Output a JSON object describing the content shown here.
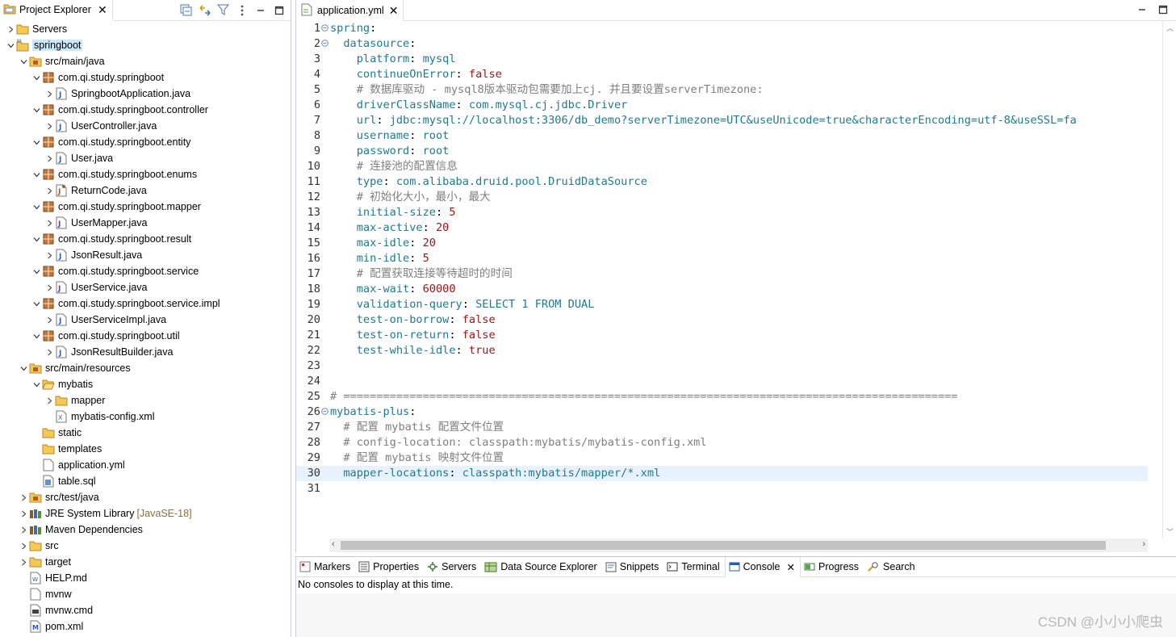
{
  "explorer": {
    "tab_label": "Project Explorer",
    "toolbar_icons": [
      "collapse-all-icon",
      "link-with-editor-icon",
      "filter-icon",
      "view-menu-icon",
      "minimize-icon",
      "maximize-icon"
    ],
    "tree": [
      {
        "label": "Servers",
        "depth": 0,
        "tw": "collapsed",
        "icon": "folder",
        "deco": ""
      },
      {
        "label": "springboot",
        "depth": 0,
        "tw": "expanded",
        "icon": "project",
        "deco": "",
        "selected": true
      },
      {
        "label": "src/main/java",
        "depth": 1,
        "tw": "expanded",
        "icon": "srcfolder",
        "deco": ""
      },
      {
        "label": "com.qi.study.springboot",
        "depth": 2,
        "tw": "expanded",
        "icon": "package",
        "deco": ""
      },
      {
        "label": "SpringbootApplication.java",
        "depth": 3,
        "tw": "collapsed",
        "icon": "java",
        "deco": ""
      },
      {
        "label": "com.qi.study.springboot.controller",
        "depth": 2,
        "tw": "expanded",
        "icon": "package",
        "deco": ""
      },
      {
        "label": "UserController.java",
        "depth": 3,
        "tw": "collapsed",
        "icon": "java",
        "deco": ""
      },
      {
        "label": "com.qi.study.springboot.entity",
        "depth": 2,
        "tw": "expanded",
        "icon": "package",
        "deco": ""
      },
      {
        "label": "User.java",
        "depth": 3,
        "tw": "collapsed",
        "icon": "java",
        "deco": ""
      },
      {
        "label": "com.qi.study.springboot.enums",
        "depth": 2,
        "tw": "expanded",
        "icon": "package",
        "deco": ""
      },
      {
        "label": "ReturnCode.java",
        "depth": 3,
        "tw": "collapsed",
        "icon": "java-enum",
        "deco": ""
      },
      {
        "label": "com.qi.study.springboot.mapper",
        "depth": 2,
        "tw": "expanded",
        "icon": "package",
        "deco": ""
      },
      {
        "label": "UserMapper.java",
        "depth": 3,
        "tw": "collapsed",
        "icon": "java-interface",
        "deco": ""
      },
      {
        "label": "com.qi.study.springboot.result",
        "depth": 2,
        "tw": "expanded",
        "icon": "package",
        "deco": ""
      },
      {
        "label": "JsonResult.java",
        "depth": 3,
        "tw": "collapsed",
        "icon": "java",
        "deco": ""
      },
      {
        "label": "com.qi.study.springboot.service",
        "depth": 2,
        "tw": "expanded",
        "icon": "package",
        "deco": ""
      },
      {
        "label": "UserService.java",
        "depth": 3,
        "tw": "collapsed",
        "icon": "java-interface",
        "deco": ""
      },
      {
        "label": "com.qi.study.springboot.service.impl",
        "depth": 2,
        "tw": "expanded",
        "icon": "package",
        "deco": ""
      },
      {
        "label": "UserServiceImpl.java",
        "depth": 3,
        "tw": "collapsed",
        "icon": "java",
        "deco": ""
      },
      {
        "label": "com.qi.study.springboot.util",
        "depth": 2,
        "tw": "expanded",
        "icon": "package",
        "deco": ""
      },
      {
        "label": "JsonResultBuilder.java",
        "depth": 3,
        "tw": "collapsed",
        "icon": "java",
        "deco": ""
      },
      {
        "label": "src/main/resources",
        "depth": 1,
        "tw": "expanded",
        "icon": "srcfolder",
        "deco": ""
      },
      {
        "label": "mybatis",
        "depth": 2,
        "tw": "expanded",
        "icon": "folder-open",
        "deco": ""
      },
      {
        "label": "mapper",
        "depth": 3,
        "tw": "collapsed",
        "icon": "folder",
        "deco": ""
      },
      {
        "label": "mybatis-config.xml",
        "depth": 3,
        "tw": "none",
        "icon": "xml",
        "deco": ""
      },
      {
        "label": "static",
        "depth": 2,
        "tw": "none",
        "icon": "folder",
        "deco": ""
      },
      {
        "label": "templates",
        "depth": 2,
        "tw": "none",
        "icon": "folder",
        "deco": ""
      },
      {
        "label": "application.yml",
        "depth": 2,
        "tw": "none",
        "icon": "file",
        "deco": ""
      },
      {
        "label": "table.sql",
        "depth": 2,
        "tw": "none",
        "icon": "sql",
        "deco": ""
      },
      {
        "label": "src/test/java",
        "depth": 1,
        "tw": "collapsed",
        "icon": "srcfolder",
        "deco": ""
      },
      {
        "label": "JRE System Library",
        "depth": 1,
        "tw": "collapsed",
        "icon": "library",
        "deco": "[JavaSE-18]"
      },
      {
        "label": "Maven Dependencies",
        "depth": 1,
        "tw": "collapsed",
        "icon": "library",
        "deco": ""
      },
      {
        "label": "src",
        "depth": 1,
        "tw": "collapsed",
        "icon": "folder",
        "deco": ""
      },
      {
        "label": "target",
        "depth": 1,
        "tw": "collapsed",
        "icon": "folder",
        "deco": ""
      },
      {
        "label": "HELP.md",
        "depth": 1,
        "tw": "none",
        "icon": "md",
        "deco": ""
      },
      {
        "label": "mvnw",
        "depth": 1,
        "tw": "none",
        "icon": "file",
        "deco": ""
      },
      {
        "label": "mvnw.cmd",
        "depth": 1,
        "tw": "none",
        "icon": "cmd",
        "deco": ""
      },
      {
        "label": "pom.xml",
        "depth": 1,
        "tw": "none",
        "icon": "pom",
        "deco": ""
      }
    ]
  },
  "editor": {
    "tab_label": "application.yml",
    "current_line": 30,
    "lines": [
      {
        "n": "1",
        "fold": true,
        "segs": [
          [
            "k",
            "spring"
          ],
          [
            "p",
            ":"
          ]
        ]
      },
      {
        "n": "2",
        "fold": true,
        "segs": [
          [
            "p",
            "  "
          ],
          [
            "k",
            "datasource"
          ],
          [
            "p",
            ":"
          ]
        ]
      },
      {
        "n": "3",
        "segs": [
          [
            "p",
            "    "
          ],
          [
            "k",
            "platform"
          ],
          [
            "p",
            ": "
          ],
          [
            "v",
            "mysql"
          ]
        ]
      },
      {
        "n": "4",
        "segs": [
          [
            "p",
            "    "
          ],
          [
            "k",
            "continueOnError"
          ],
          [
            "p",
            ": "
          ],
          [
            "n",
            "false"
          ]
        ]
      },
      {
        "n": "5",
        "segs": [
          [
            "p",
            "    "
          ],
          [
            "c",
            "# 数据库驱动 - mysql8版本驱动包需要加上cj. 并且要设置serverTimezone:"
          ]
        ]
      },
      {
        "n": "6",
        "segs": [
          [
            "p",
            "    "
          ],
          [
            "k",
            "driverClassName"
          ],
          [
            "p",
            ": "
          ],
          [
            "v",
            "com.mysql.cj.jdbc.Driver"
          ]
        ]
      },
      {
        "n": "7",
        "segs": [
          [
            "p",
            "    "
          ],
          [
            "k",
            "url"
          ],
          [
            "p",
            ": "
          ],
          [
            "v",
            "jdbc:mysql://localhost:3306/db_demo?serverTimezone=UTC&useUnicode=true&characterEncoding=utf-8&useSSL=fa"
          ]
        ]
      },
      {
        "n": "8",
        "segs": [
          [
            "p",
            "    "
          ],
          [
            "k",
            "username"
          ],
          [
            "p",
            ": "
          ],
          [
            "v",
            "root"
          ]
        ]
      },
      {
        "n": "9",
        "segs": [
          [
            "p",
            "    "
          ],
          [
            "k",
            "password"
          ],
          [
            "p",
            ": "
          ],
          [
            "v",
            "root"
          ]
        ]
      },
      {
        "n": "10",
        "segs": [
          [
            "p",
            "    "
          ],
          [
            "c",
            "# 连接池的配置信息"
          ]
        ]
      },
      {
        "n": "11",
        "segs": [
          [
            "p",
            "    "
          ],
          [
            "k",
            "type"
          ],
          [
            "p",
            ": "
          ],
          [
            "v",
            "com.alibaba.druid.pool.DruidDataSource"
          ]
        ]
      },
      {
        "n": "12",
        "segs": [
          [
            "p",
            "    "
          ],
          [
            "c",
            "# 初始化大小，最小，最大"
          ]
        ]
      },
      {
        "n": "13",
        "segs": [
          [
            "p",
            "    "
          ],
          [
            "k",
            "initial-size"
          ],
          [
            "p",
            ": "
          ],
          [
            "n",
            "5"
          ]
        ]
      },
      {
        "n": "14",
        "segs": [
          [
            "p",
            "    "
          ],
          [
            "k",
            "max-active"
          ],
          [
            "p",
            ": "
          ],
          [
            "n",
            "20"
          ]
        ]
      },
      {
        "n": "15",
        "segs": [
          [
            "p",
            "    "
          ],
          [
            "k",
            "max-idle"
          ],
          [
            "p",
            ": "
          ],
          [
            "n",
            "20"
          ]
        ]
      },
      {
        "n": "16",
        "segs": [
          [
            "p",
            "    "
          ],
          [
            "k",
            "min-idle"
          ],
          [
            "p",
            ": "
          ],
          [
            "n",
            "5"
          ]
        ]
      },
      {
        "n": "17",
        "segs": [
          [
            "p",
            "    "
          ],
          [
            "c",
            "# 配置获取连接等待超时的时间"
          ]
        ]
      },
      {
        "n": "18",
        "segs": [
          [
            "p",
            "    "
          ],
          [
            "k",
            "max-wait"
          ],
          [
            "p",
            ": "
          ],
          [
            "n",
            "60000"
          ]
        ]
      },
      {
        "n": "19",
        "segs": [
          [
            "p",
            "    "
          ],
          [
            "k",
            "validation-query"
          ],
          [
            "p",
            ": "
          ],
          [
            "v",
            "SELECT 1 FROM DUAL"
          ]
        ]
      },
      {
        "n": "20",
        "segs": [
          [
            "p",
            "    "
          ],
          [
            "k",
            "test-on-borrow"
          ],
          [
            "p",
            ": "
          ],
          [
            "n",
            "false"
          ]
        ]
      },
      {
        "n": "21",
        "segs": [
          [
            "p",
            "    "
          ],
          [
            "k",
            "test-on-return"
          ],
          [
            "p",
            ": "
          ],
          [
            "n",
            "false"
          ]
        ]
      },
      {
        "n": "22",
        "segs": [
          [
            "p",
            "    "
          ],
          [
            "k",
            "test-while-idle"
          ],
          [
            "p",
            ": "
          ],
          [
            "n",
            "true"
          ]
        ]
      },
      {
        "n": "23",
        "segs": []
      },
      {
        "n": "24",
        "segs": []
      },
      {
        "n": "25",
        "segs": [
          [
            "c",
            "# ============================================================================================="
          ]
        ]
      },
      {
        "n": "26",
        "fold": true,
        "segs": [
          [
            "k",
            "mybatis-plus"
          ],
          [
            "p",
            ":"
          ]
        ]
      },
      {
        "n": "27",
        "segs": [
          [
            "p",
            "  "
          ],
          [
            "c",
            "# 配置 mybatis 配置文件位置"
          ]
        ]
      },
      {
        "n": "28",
        "segs": [
          [
            "p",
            "  "
          ],
          [
            "c",
            "# config-location: classpath:mybatis/mybatis-config.xml"
          ]
        ]
      },
      {
        "n": "29",
        "segs": [
          [
            "p",
            "  "
          ],
          [
            "c",
            "# 配置 mybatis 映射文件位置"
          ]
        ]
      },
      {
        "n": "30",
        "segs": [
          [
            "p",
            "  "
          ],
          [
            "k",
            "mapper-locations"
          ],
          [
            "p",
            ": "
          ],
          [
            "v",
            "classpath:mybatis/mapper/*.xml"
          ]
        ]
      },
      {
        "n": "31",
        "segs": []
      }
    ]
  },
  "bottom": {
    "tabs": [
      {
        "label": "Markers",
        "icon": "markers-icon"
      },
      {
        "label": "Properties",
        "icon": "properties-icon"
      },
      {
        "label": "Servers",
        "icon": "servers-icon"
      },
      {
        "label": "Data Source Explorer",
        "icon": "data-source-icon"
      },
      {
        "label": "Snippets",
        "icon": "snippets-icon"
      },
      {
        "label": "Terminal",
        "icon": "terminal-icon"
      },
      {
        "label": "Console",
        "icon": "console-icon",
        "active": true
      },
      {
        "label": "Progress",
        "icon": "progress-icon"
      },
      {
        "label": "Search",
        "icon": "search-icon"
      }
    ],
    "console_message": "No consoles to display at this time."
  },
  "watermark": "CSDN @小小小爬虫",
  "colors": {
    "key": "#1f7a8c",
    "number": "#a31515",
    "comment": "#7f7f7f",
    "selection": "#cce8ff",
    "current_line": "#e8f2fe"
  }
}
